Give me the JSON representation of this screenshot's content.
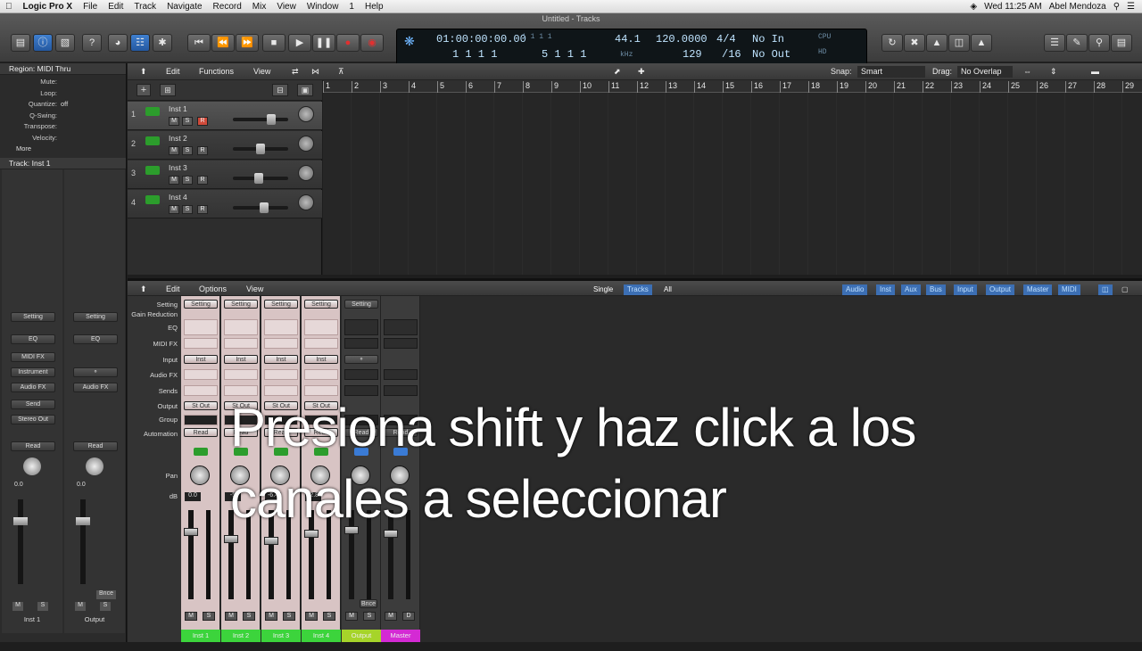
{
  "menubar": {
    "apple": "",
    "app": "Logic Pro X",
    "items": [
      "File",
      "Edit",
      "Track",
      "Navigate",
      "Record",
      "Mix",
      "View",
      "Window",
      "1",
      "Help"
    ],
    "clock": "Wed 11:25 AM",
    "user": "Abel Mendoza"
  },
  "window": {
    "title": "Untitled - Tracks"
  },
  "lcd": {
    "time": "01:00:00:00.00",
    "bars": "1  1  1  1",
    "bars2": "1  1  1  1",
    "bars3": "5  1  1  1",
    "rate": "44.1",
    "rate_unit": "kHz",
    "tempo": "120.0000",
    "tempo2": "129",
    "sig": "4/4",
    "div": "/16",
    "in": "No In",
    "out": "No Out",
    "cpu": "CPU",
    "hd": "HD"
  },
  "inspector": {
    "region_header": "Region: MIDI Thru",
    "rows": [
      {
        "k": "Mute:",
        "v": ""
      },
      {
        "k": "Loop:",
        "v": ""
      },
      {
        "k": "Quantize:",
        "v": "off"
      },
      {
        "k": "Q-Swing:",
        "v": ""
      },
      {
        "k": "Transpose:",
        "v": ""
      },
      {
        "k": "Velocity:",
        "v": ""
      }
    ],
    "more": "More",
    "track_header": "Track:  Inst 1",
    "strip1": {
      "setting": "Setting",
      "eq": "EQ",
      "midifx": "MIDI FX",
      "instrument": "Instrument",
      "audiofx": "Audio FX",
      "send": "Send",
      "output": "Stereo Out",
      "read": "Read",
      "value": "0.0",
      "name": "Inst 1",
      "m": "M",
      "s": "S"
    },
    "strip2": {
      "setting": "Setting",
      "eq": "EQ",
      "audiofx": "Audio FX",
      "read": "Read",
      "value": "0.0",
      "name": "Output",
      "bnce": "Bnce",
      "m": "M",
      "s": "S"
    }
  },
  "tracks_bar": {
    "edit": "Edit",
    "functions": "Functions",
    "view": "View",
    "snap_label": "Snap:",
    "snap": "Smart",
    "drag_label": "Drag:",
    "drag": "No Overlap"
  },
  "tracks": [
    {
      "num": "1",
      "name": "Inst 1",
      "m": "M",
      "s": "S",
      "r": "R"
    },
    {
      "num": "2",
      "name": "Inst 2",
      "m": "M",
      "s": "S",
      "r": "R"
    },
    {
      "num": "3",
      "name": "Inst 3",
      "m": "M",
      "s": "S",
      "r": "R"
    },
    {
      "num": "4",
      "name": "Inst 4",
      "m": "M",
      "s": "S",
      "r": "R"
    }
  ],
  "ruler": [
    "1",
    "2",
    "3",
    "4",
    "5",
    "6",
    "7",
    "8",
    "9",
    "10",
    "11",
    "12",
    "13",
    "14",
    "15",
    "16",
    "17",
    "18",
    "19",
    "20",
    "21",
    "22",
    "23",
    "24",
    "25",
    "26",
    "27",
    "28",
    "29"
  ],
  "mixer_bar": {
    "edit": "Edit",
    "options": "Options",
    "view": "View",
    "single": "Single",
    "tracks": "Tracks",
    "all": "All",
    "filters": [
      "Audio",
      "Inst",
      "Aux",
      "Bus",
      "Input",
      "Output",
      "Master",
      "MIDI"
    ]
  },
  "mixer_labels": {
    "setting": "Setting",
    "gain": "Gain Reduction",
    "eq": "EQ",
    "midifx": "MIDI FX",
    "input": "Input",
    "audiofx": "Audio FX",
    "sends": "Sends",
    "output": "Output",
    "group": "Group",
    "automation": "Automation",
    "pan": "Pan",
    "db": "dB"
  },
  "channels": [
    {
      "name": "Inst 1",
      "setting": "Setting",
      "input": "Inst",
      "output": "St Out",
      "auto": "Read",
      "db": "0.0",
      "m": "M",
      "s": "S",
      "color": "#3cd43c"
    },
    {
      "name": "Inst 2",
      "setting": "Setting",
      "input": "Inst",
      "output": "St Out",
      "auto": "Read",
      "db": "-5",
      "m": "M",
      "s": "S",
      "color": "#3cd43c"
    },
    {
      "name": "Inst 3",
      "setting": "Setting",
      "input": "Inst",
      "output": "St Out",
      "auto": "Read",
      "db": "-6.4",
      "m": "M",
      "s": "S",
      "color": "#3cd43c"
    },
    {
      "name": "Inst 4",
      "setting": "Setting",
      "input": "Inst",
      "output": "St Out",
      "auto": "Read",
      "db": "-2.8",
      "m": "M",
      "s": "S",
      "color": "#3cd43c"
    },
    {
      "name": "Output",
      "setting": "Setting",
      "input": "",
      "output": "",
      "auto": "Read",
      "db": "",
      "m": "M",
      "s": "S",
      "bnce": "Bnce",
      "color": "#a6d42a"
    },
    {
      "name": "Master",
      "setting": "",
      "input": "",
      "output": "",
      "auto": "Read",
      "db": "",
      "m": "M",
      "s": "D",
      "color": "#d42ad4"
    }
  ],
  "overlay": {
    "line1": "Presiona shift y haz click a los",
    "line2": "canales a seleccionar"
  }
}
